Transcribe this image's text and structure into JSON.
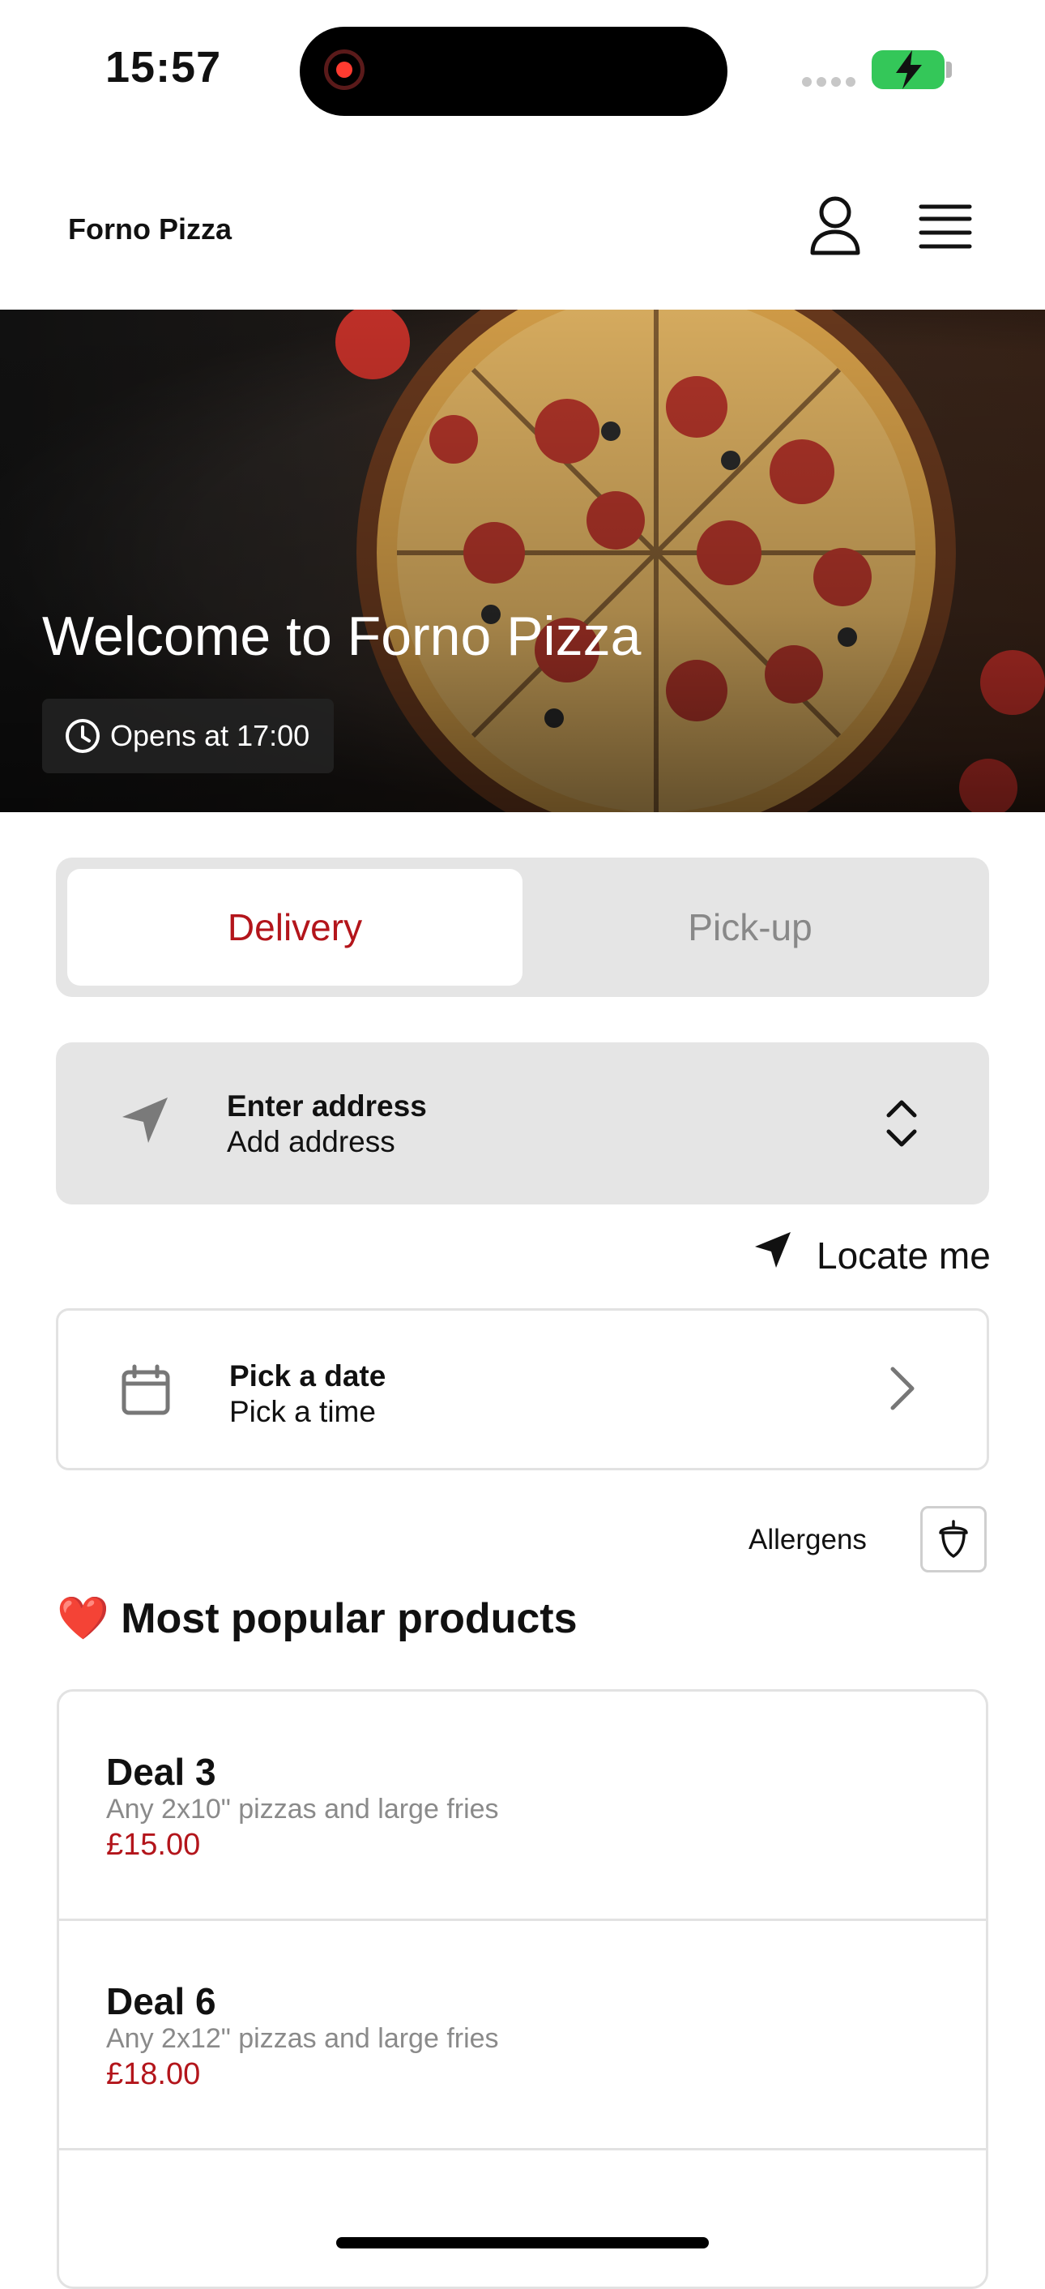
{
  "status_bar": {
    "time": "15:57"
  },
  "header": {
    "brand": "Forno Pizza"
  },
  "hero": {
    "title": "Welcome to Forno Pizza",
    "hours": "Opens at 17:00"
  },
  "order_mode": {
    "tabs": [
      {
        "label": "Delivery",
        "active": true
      },
      {
        "label": "Pick-up",
        "active": false
      }
    ]
  },
  "address": {
    "title": "Enter address",
    "subtitle": "Add address"
  },
  "locate": {
    "label": "Locate me"
  },
  "date_picker": {
    "title": "Pick a date",
    "subtitle": "Pick a time"
  },
  "allergens": {
    "label": "Allergens"
  },
  "popular": {
    "title": "Most popular products",
    "emoji": "❤️",
    "items": [
      {
        "name": "Deal 3",
        "description": "Any 2x10\" pizzas and large fries",
        "price": "£15.00"
      },
      {
        "name": "Deal 6",
        "description": "Any 2x12\" pizzas and large fries",
        "price": "£18.00"
      }
    ]
  },
  "colors": {
    "accent": "#b3151b",
    "battery": "#34c759"
  }
}
